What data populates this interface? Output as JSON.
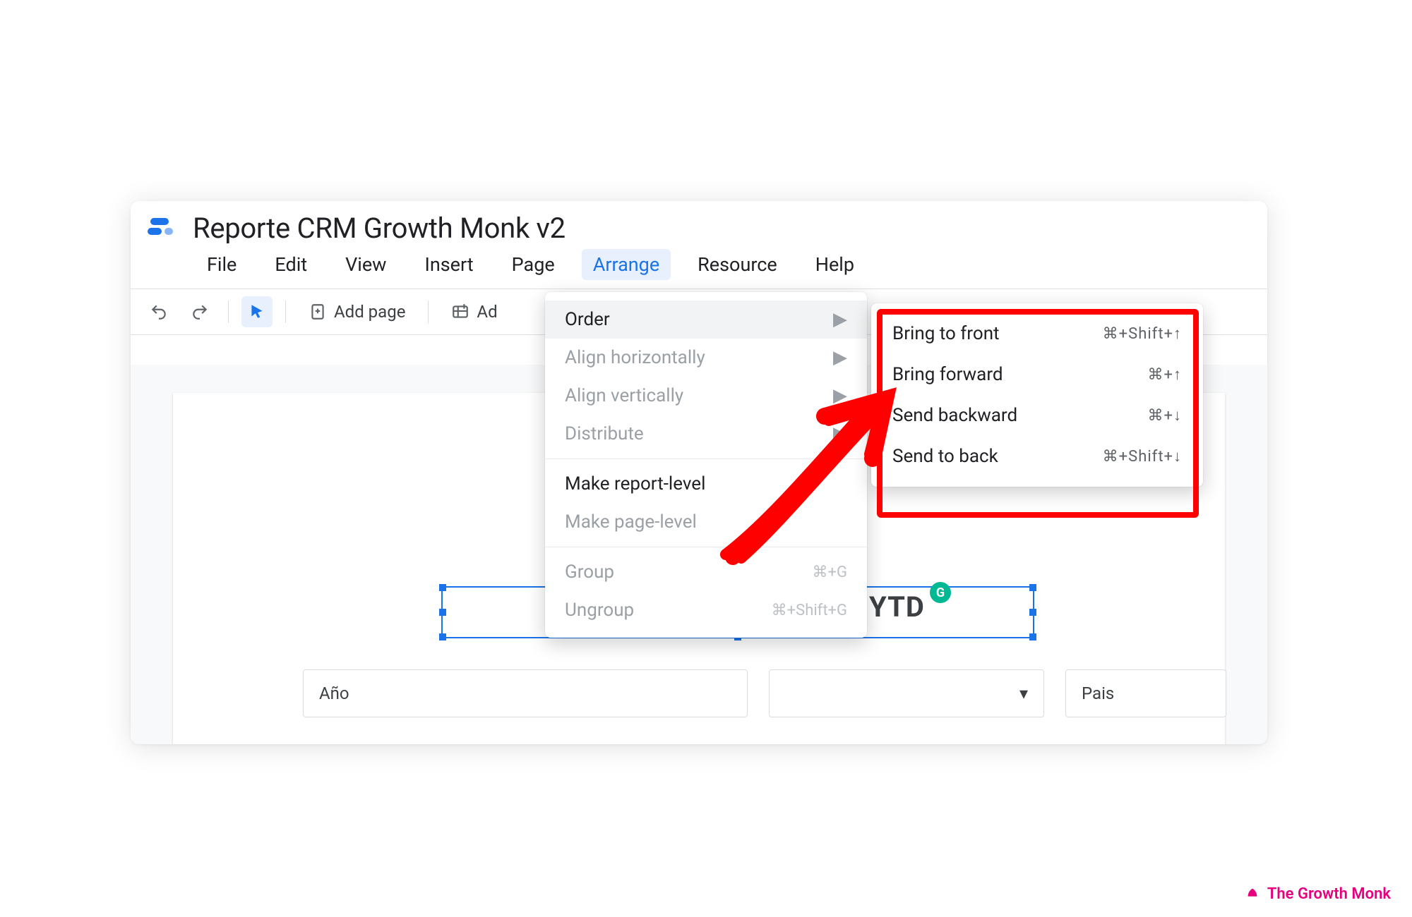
{
  "doc_title": "Reporte CRM Growth Monk v2",
  "menubar": {
    "items": [
      {
        "label": "File"
      },
      {
        "label": "Edit"
      },
      {
        "label": "View"
      },
      {
        "label": "Insert"
      },
      {
        "label": "Page"
      },
      {
        "label": "Arrange"
      },
      {
        "label": "Resource"
      },
      {
        "label": "Help"
      }
    ],
    "active_index": 5
  },
  "toolbar": {
    "add_page_label": "Add page",
    "add_truncated_label": "Ad"
  },
  "arrange_menu": {
    "items": [
      {
        "label": "Order",
        "has_submenu": true,
        "disabled": false,
        "hover": true
      },
      {
        "label": "Align horizontally",
        "has_submenu": true,
        "disabled": true
      },
      {
        "label": "Align vertically",
        "has_submenu": true,
        "disabled": true
      },
      {
        "label": "Distribute",
        "has_submenu": true,
        "disabled": true
      },
      {
        "sep": true
      },
      {
        "label": "Make report-level",
        "disabled": false
      },
      {
        "label": "Make page-level",
        "disabled": true
      },
      {
        "sep": true
      },
      {
        "label": "Group",
        "disabled": true,
        "shortcut": "⌘+G"
      },
      {
        "label": "Ungroup",
        "disabled": true,
        "shortcut": "⌘+Shift+G"
      }
    ]
  },
  "order_submenu": {
    "items": [
      {
        "label": "Bring to front",
        "shortcut": "⌘+Shift+↑"
      },
      {
        "label": "Bring forward",
        "shortcut": "⌘+↑"
      },
      {
        "label": "Send backward",
        "shortcut": "⌘+↓"
      },
      {
        "label": "Send to back",
        "shortcut": "⌘+Shift+↓"
      }
    ]
  },
  "canvas": {
    "selected_text": "YTD",
    "badge_letter": "G",
    "filter1_label": "Año",
    "filter3_label": "Pais"
  },
  "attribution": "The Growth Monk"
}
